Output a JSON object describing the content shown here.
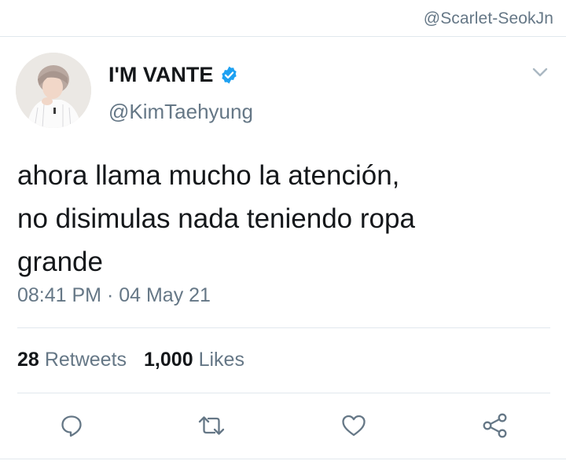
{
  "watermark": "@Scarlet-SeokJn",
  "author": {
    "display_name": "I'M VANTE",
    "handle": "@KimTaehyung",
    "verified": true
  },
  "tweet": {
    "lines": [
      "ahora llama mucho la atención,",
      "no disimulas nada teniendo ropa",
      "grande"
    ],
    "timestamp": "08:41 PM · 04 May 21"
  },
  "stats": {
    "retweets_count": "28",
    "retweets_label": "Retweets",
    "likes_count": "1,000",
    "likes_label": "Likes"
  },
  "icons": {
    "reply": "reply-icon",
    "retweet": "retweet-icon",
    "like": "heart-icon",
    "share": "share-icon",
    "menu": "chevron-down-icon",
    "verified": "verified-badge-icon"
  },
  "colors": {
    "text_primary": "#14171a",
    "text_secondary": "#657786",
    "verified_blue": "#1da1f2",
    "divider": "#e1e8ed"
  }
}
